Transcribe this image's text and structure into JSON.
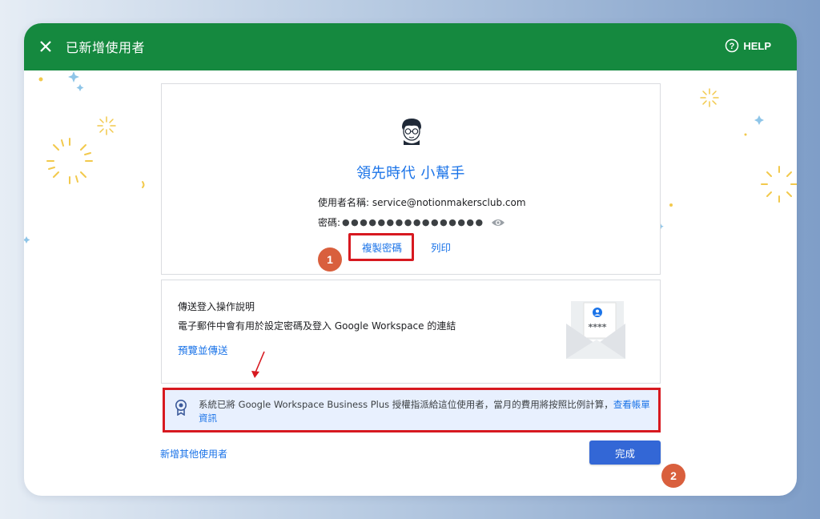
{
  "window": {
    "title": "已新增使用者",
    "help_label": "HELP"
  },
  "user_card": {
    "display_name": "領先時代 小幫手",
    "username_label": "使用者名稱:",
    "username_value": "service@notionmakersclub.com",
    "password_label": "密碼:",
    "password_mask": "●●●●●●●●●●●●●●●●",
    "copy_password": "複製密碼",
    "print": "列印"
  },
  "send_card": {
    "title": "傳送登入操作說明",
    "description": "電子郵件中會有用於設定密碼及登入 Google Workspace 的連結",
    "preview_link": "預覽並傳送",
    "envelope_stars": "****"
  },
  "notice": {
    "text": "系統已將 Google Workspace Business Plus 授權指派給這位使用者，當月的費用將按照比例計算，",
    "link": "查看帳單資訊"
  },
  "footer": {
    "add_more": "新增其他使用者",
    "done": "完成"
  },
  "annotations": {
    "step_1": "1",
    "step_2": "2"
  },
  "colors": {
    "header_green": "#15893f",
    "link_blue": "#1a73e8",
    "primary_button": "#3367d6",
    "highlight_red": "#d71920",
    "badge_orange": "#d95f3d",
    "notice_bg": "#e8f0fe"
  },
  "icons": [
    "close-icon",
    "help-icon",
    "avatar",
    "eye-icon",
    "envelope-icon",
    "license-badge-icon",
    "arrow-icon"
  ]
}
